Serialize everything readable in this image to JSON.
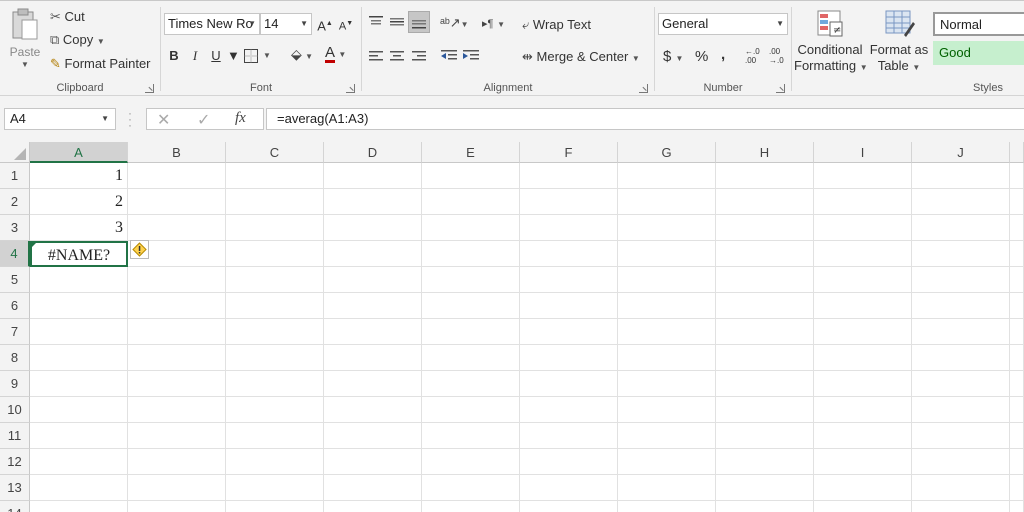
{
  "clipboard": {
    "paste_label": "Paste",
    "cut_label": "Cut",
    "copy_label": "Copy",
    "format_painter_label": "Format Painter",
    "group_label": "Clipboard"
  },
  "font": {
    "font_name": "Times New Ro",
    "font_size": "14",
    "grow_label": "A",
    "shrink_label": "A",
    "bold_label": "B",
    "italic_label": "I",
    "underline_label": "U",
    "font_color_label": "A",
    "group_label": "Font"
  },
  "alignment": {
    "wrap_text_label": "Wrap Text",
    "merge_center_label": "Merge & Center",
    "group_label": "Alignment"
  },
  "number": {
    "format_value": "General",
    "currency_label": "$",
    "percent_label": "%",
    "comma_label": ",",
    "group_label": "Number"
  },
  "styles": {
    "conditional_line1": "Conditional",
    "conditional_line2": "Formatting",
    "format_table_line1": "Format as",
    "format_table_line2": "Table",
    "normal_label": "Normal",
    "good_label": "Good",
    "group_label": "Styles"
  },
  "formula_bar": {
    "name_box": "A4",
    "fx_label": "fx",
    "formula": "=averag(A1:A3)"
  },
  "columns": [
    "A",
    "B",
    "C",
    "D",
    "E",
    "F",
    "G",
    "H",
    "I",
    "J"
  ],
  "rows": [
    "1",
    "2",
    "3",
    "4",
    "5",
    "6",
    "7",
    "8",
    "9",
    "10",
    "11",
    "12",
    "13",
    "14"
  ],
  "cells": {
    "A1": "1",
    "A2": "2",
    "A3": "3",
    "A4": "#NAME?"
  },
  "colors": {
    "accent": "#217346",
    "good_bg": "#c6efce",
    "good_text": "#006100",
    "font_color_bar": "#c00000"
  }
}
